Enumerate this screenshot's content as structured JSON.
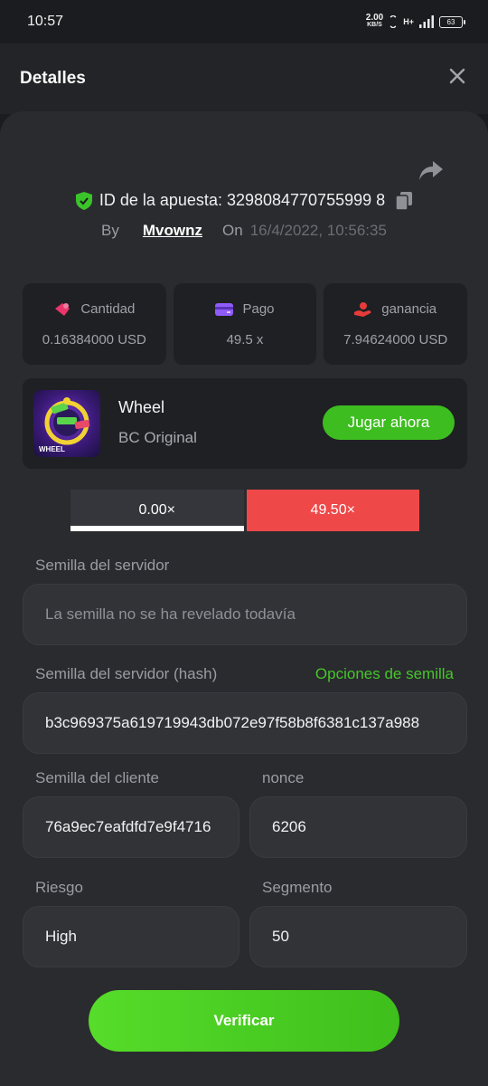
{
  "status_bar": {
    "time": "10:57",
    "net_speed_value": "2.00",
    "net_speed_unit": "KB/S",
    "network_type": "H+",
    "battery": "63"
  },
  "header": {
    "title": "Detalles"
  },
  "bet": {
    "id_label": "ID de la apuesta: 3298084770755999 8",
    "by_label": "By",
    "user": "Mvownz",
    "on_label": "On",
    "datetime": "16/4/2022, 10:56:35"
  },
  "stats": [
    {
      "label": "Cantidad",
      "value": "0.16384000 USD",
      "icon": "coins-icon",
      "color": "#e8366b"
    },
    {
      "label": "Pago",
      "value": "49.5 x",
      "icon": "wallet-icon",
      "color": "#8f5cf7"
    },
    {
      "label": "ganancia",
      "value": "7.94624000 USD",
      "icon": "hand-coins-icon",
      "color": "#e63b3b"
    }
  ],
  "game": {
    "name": "Wheel",
    "subtitle": "BC Original",
    "thumb_label": "WHEEL",
    "play_label": "Jugar ahora"
  },
  "multipliers": {
    "left": "0.00×",
    "right": "49.50×"
  },
  "form": {
    "server_seed_label": "Semilla del servidor",
    "server_seed_value": "La semilla no se ha revelado todavía",
    "server_hash_label": "Semilla del servidor (hash)",
    "seed_options_label": "Opciones de semilla",
    "server_hash_value": "b3c969375a619719943db072e97f58b8f6381c137a988",
    "client_seed_label": "Semilla del cliente",
    "client_seed_value": "76a9ec7eafdfd7e9f4716",
    "nonce_label": "nonce",
    "nonce_value": "6206",
    "risk_label": "Riesgo",
    "risk_value": "High",
    "segment_label": "Segmento",
    "segment_value": "50"
  },
  "verify_label": "Verificar",
  "colors": {
    "accent_green": "#3dbd20",
    "danger_red": "#ef4848"
  }
}
